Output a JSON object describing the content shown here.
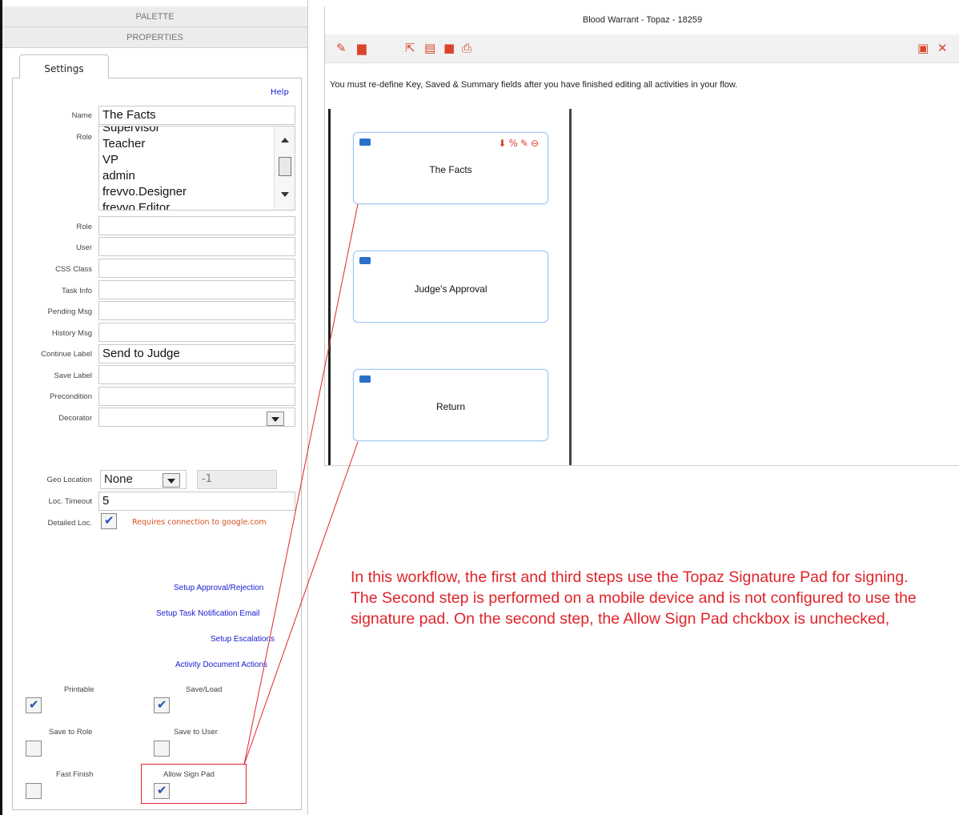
{
  "left_panel": {
    "palette_label": "PALETTE",
    "properties_label": "PROPERTIES",
    "tab_label": "Settings",
    "help_label": "Help",
    "name": {
      "label": "Name",
      "value": "The Facts"
    },
    "role_list": {
      "label": "Role",
      "items": [
        "Supervisor",
        "Teacher",
        "VP",
        "admin",
        "frevvo.Designer",
        "frevvo.Editor"
      ]
    },
    "fields": [
      {
        "label": "Role",
        "value": ""
      },
      {
        "label": "User",
        "value": ""
      },
      {
        "label": "CSS Class",
        "value": ""
      },
      {
        "label": "Task Info",
        "value": ""
      },
      {
        "label": "Pending Msg",
        "value": ""
      },
      {
        "label": "History Msg",
        "value": ""
      },
      {
        "label": "Continue Label",
        "value": "Send to Judge"
      },
      {
        "label": "Save Label",
        "value": ""
      },
      {
        "label": "Precondition",
        "value": ""
      },
      {
        "label": "Decorator",
        "value": ""
      }
    ],
    "geo_location": {
      "label": "Geo Location",
      "value": "None",
      "number": "-1"
    },
    "loc_timeout": {
      "label": "Loc. Timeout",
      "value": "5"
    },
    "detailed_loc": {
      "label": "Detailed Loc.",
      "checked": true,
      "note": "Requires connection to google.com"
    },
    "links": [
      "Setup Approval/Rejection",
      "Setup Task Notification Email",
      "Setup Escalations",
      "Activity Document Actions"
    ],
    "checkboxes": [
      {
        "label": "Printable",
        "checked": true
      },
      {
        "label": "Save/Load",
        "checked": true
      },
      {
        "label": "Save to Role",
        "checked": false
      },
      {
        "label": "Save to User",
        "checked": false
      },
      {
        "label": "Fast Finish",
        "checked": false
      },
      {
        "label": "Allow Sign Pad",
        "checked": true
      }
    ]
  },
  "right_panel": {
    "title": "Blood Warrant - Topaz - 18259",
    "toolbar_icons": [
      "pencil-icon",
      "document-icon",
      "external-link-icon",
      "copy-icon",
      "lock-icon",
      "print-icon",
      "save-icon",
      "close-icon"
    ],
    "info_text": "You must re-define Key, Saved & Summary fields after you have finished editing all activities in your flow.",
    "steps": [
      {
        "title": "The Facts",
        "actions": [
          "download-icon",
          "link-icon",
          "pencil-icon",
          "remove-icon"
        ]
      },
      {
        "title": "Judge's Approval"
      },
      {
        "title": "Return"
      }
    ]
  },
  "annotation": {
    "text": "In this workflow, the first and third steps use the Topaz Signature Pad for signing. The Second step is performed on a mobile device and is not configured to use the signature pad. On the second step, the Allow Sign Pad chckbox is unchecked,",
    "color": "#e0242a"
  }
}
